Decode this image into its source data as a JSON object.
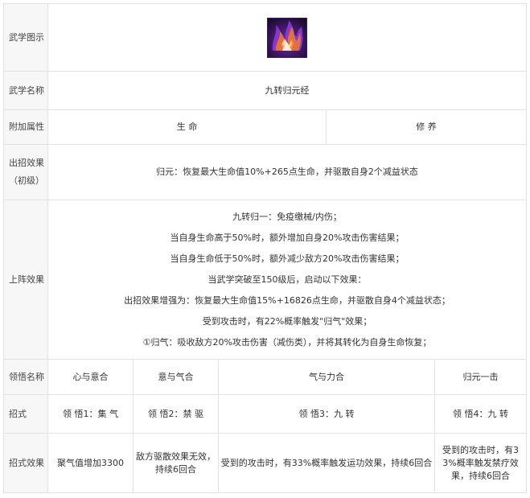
{
  "rows": {
    "icon_label": "武学图示",
    "name_label": "武学名称",
    "name_value": "九转归元经",
    "attr_label": "附加属性",
    "attr_1": "生 命",
    "attr_2": "修 养",
    "effect_label_1": "出招效果",
    "effect_label_2": "（初级）",
    "effect_value": "归元：恢复最大生命值10%+265点生命，并驱散自身2个减益状态",
    "formation_label": "上阵效果",
    "formation_lines": [
      "九转归一：免疫缴械/内伤；",
      "当自身生命高于50%时，额外增加自身20%攻击伤害结果；",
      "当自身生命低于50%时，额外减少敌方20%攻击伤害结果；",
      "当武学突破至150级后，启动以下效果：",
      "出招效果增强为：恢复最大生命值15%+16826点生命，并驱散自身4个减益状态；",
      "受到攻击时，有22%概率触发\"归气\"效果；",
      "①归气：吸收敌方20%攻击伤害（减伤类），并将其转化为自身生命恢复；"
    ],
    "insight_label": "领悟名称",
    "insights": [
      "心与意合",
      "意与气合",
      "气与力合",
      "归元一击"
    ],
    "move_label": "招式",
    "moves": [
      "领 悟1：集 气",
      "领 悟2：禁 驱",
      "领 悟3：九 转",
      "领 悟4：九 转"
    ],
    "move_effect_label": "招式效果",
    "move_effects": [
      "聚气值增加3300",
      "敌方驱散效果无效，持续6回合",
      "受到的攻击时，有33%概率触发运功效果，持续6回合",
      "受到的攻击时，有33%概率触发禁疗效果，持续6回合"
    ]
  },
  "icon": {
    "name": "flame-icon",
    "colors": {
      "bg": "#2a0f44",
      "purple": "#8a3ad6",
      "orange": "#f07a2a",
      "yellow": "#ffd76a",
      "white": "#fff4e6"
    }
  }
}
